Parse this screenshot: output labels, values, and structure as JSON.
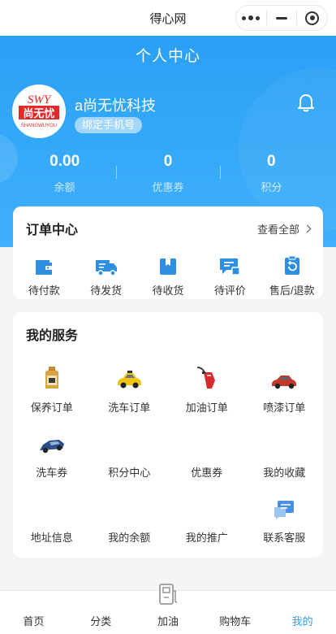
{
  "window": {
    "app_title": "得心网"
  },
  "header": {
    "page_title": "个人中心",
    "nickname": "a尚无忧科技",
    "bind_phone_label": "绑定手机号",
    "avatar": {
      "brand_top": "SWY",
      "brand_cn": "尚无忧",
      "brand_pinyin": "SHANGWUYOU"
    }
  },
  "stats": [
    {
      "value": "0.00",
      "label": "余额"
    },
    {
      "value": "0",
      "label": "优惠券"
    },
    {
      "value": "0",
      "label": "积分"
    }
  ],
  "orders": {
    "title": "订单中心",
    "view_all": "查看全部",
    "items": [
      {
        "label": "待付款",
        "icon": "wallet-icon"
      },
      {
        "label": "待发货",
        "icon": "truck-icon"
      },
      {
        "label": "待收货",
        "icon": "package-icon"
      },
      {
        "label": "待评价",
        "icon": "comment-icon"
      },
      {
        "label": "售后/退款",
        "icon": "refund-icon"
      }
    ]
  },
  "services": {
    "title": "我的服务",
    "items": [
      {
        "label": "保养订单",
        "icon": "oil-bottle-icon"
      },
      {
        "label": "洗车订单",
        "icon": "yellow-car-icon"
      },
      {
        "label": "加油订单",
        "icon": "fuel-nozzle-icon"
      },
      {
        "label": "喷漆订单",
        "icon": "red-car-icon"
      },
      {
        "label": "洗车券",
        "icon": "blue-car-icon"
      },
      {
        "label": "积分中心",
        "icon": ""
      },
      {
        "label": "优惠券",
        "icon": ""
      },
      {
        "label": "我的收藏",
        "icon": ""
      },
      {
        "label": "地址信息",
        "icon": ""
      },
      {
        "label": "我的余额",
        "icon": ""
      },
      {
        "label": "我的推广",
        "icon": ""
      },
      {
        "label": "联系客服",
        "icon": "chat-bubble-icon"
      }
    ]
  },
  "tabbar": [
    {
      "label": "首页",
      "active": false
    },
    {
      "label": "分类",
      "active": false
    },
    {
      "label": "加油",
      "active": false,
      "icon": "fuel-station-icon"
    },
    {
      "label": "购物车",
      "active": false
    },
    {
      "label": "我的",
      "active": true
    }
  ],
  "colors": {
    "primary_blue": "#2aa0f5",
    "icon_blue": "#2e8fe0",
    "text_dark": "#333333",
    "background": "#f5f5f5"
  }
}
